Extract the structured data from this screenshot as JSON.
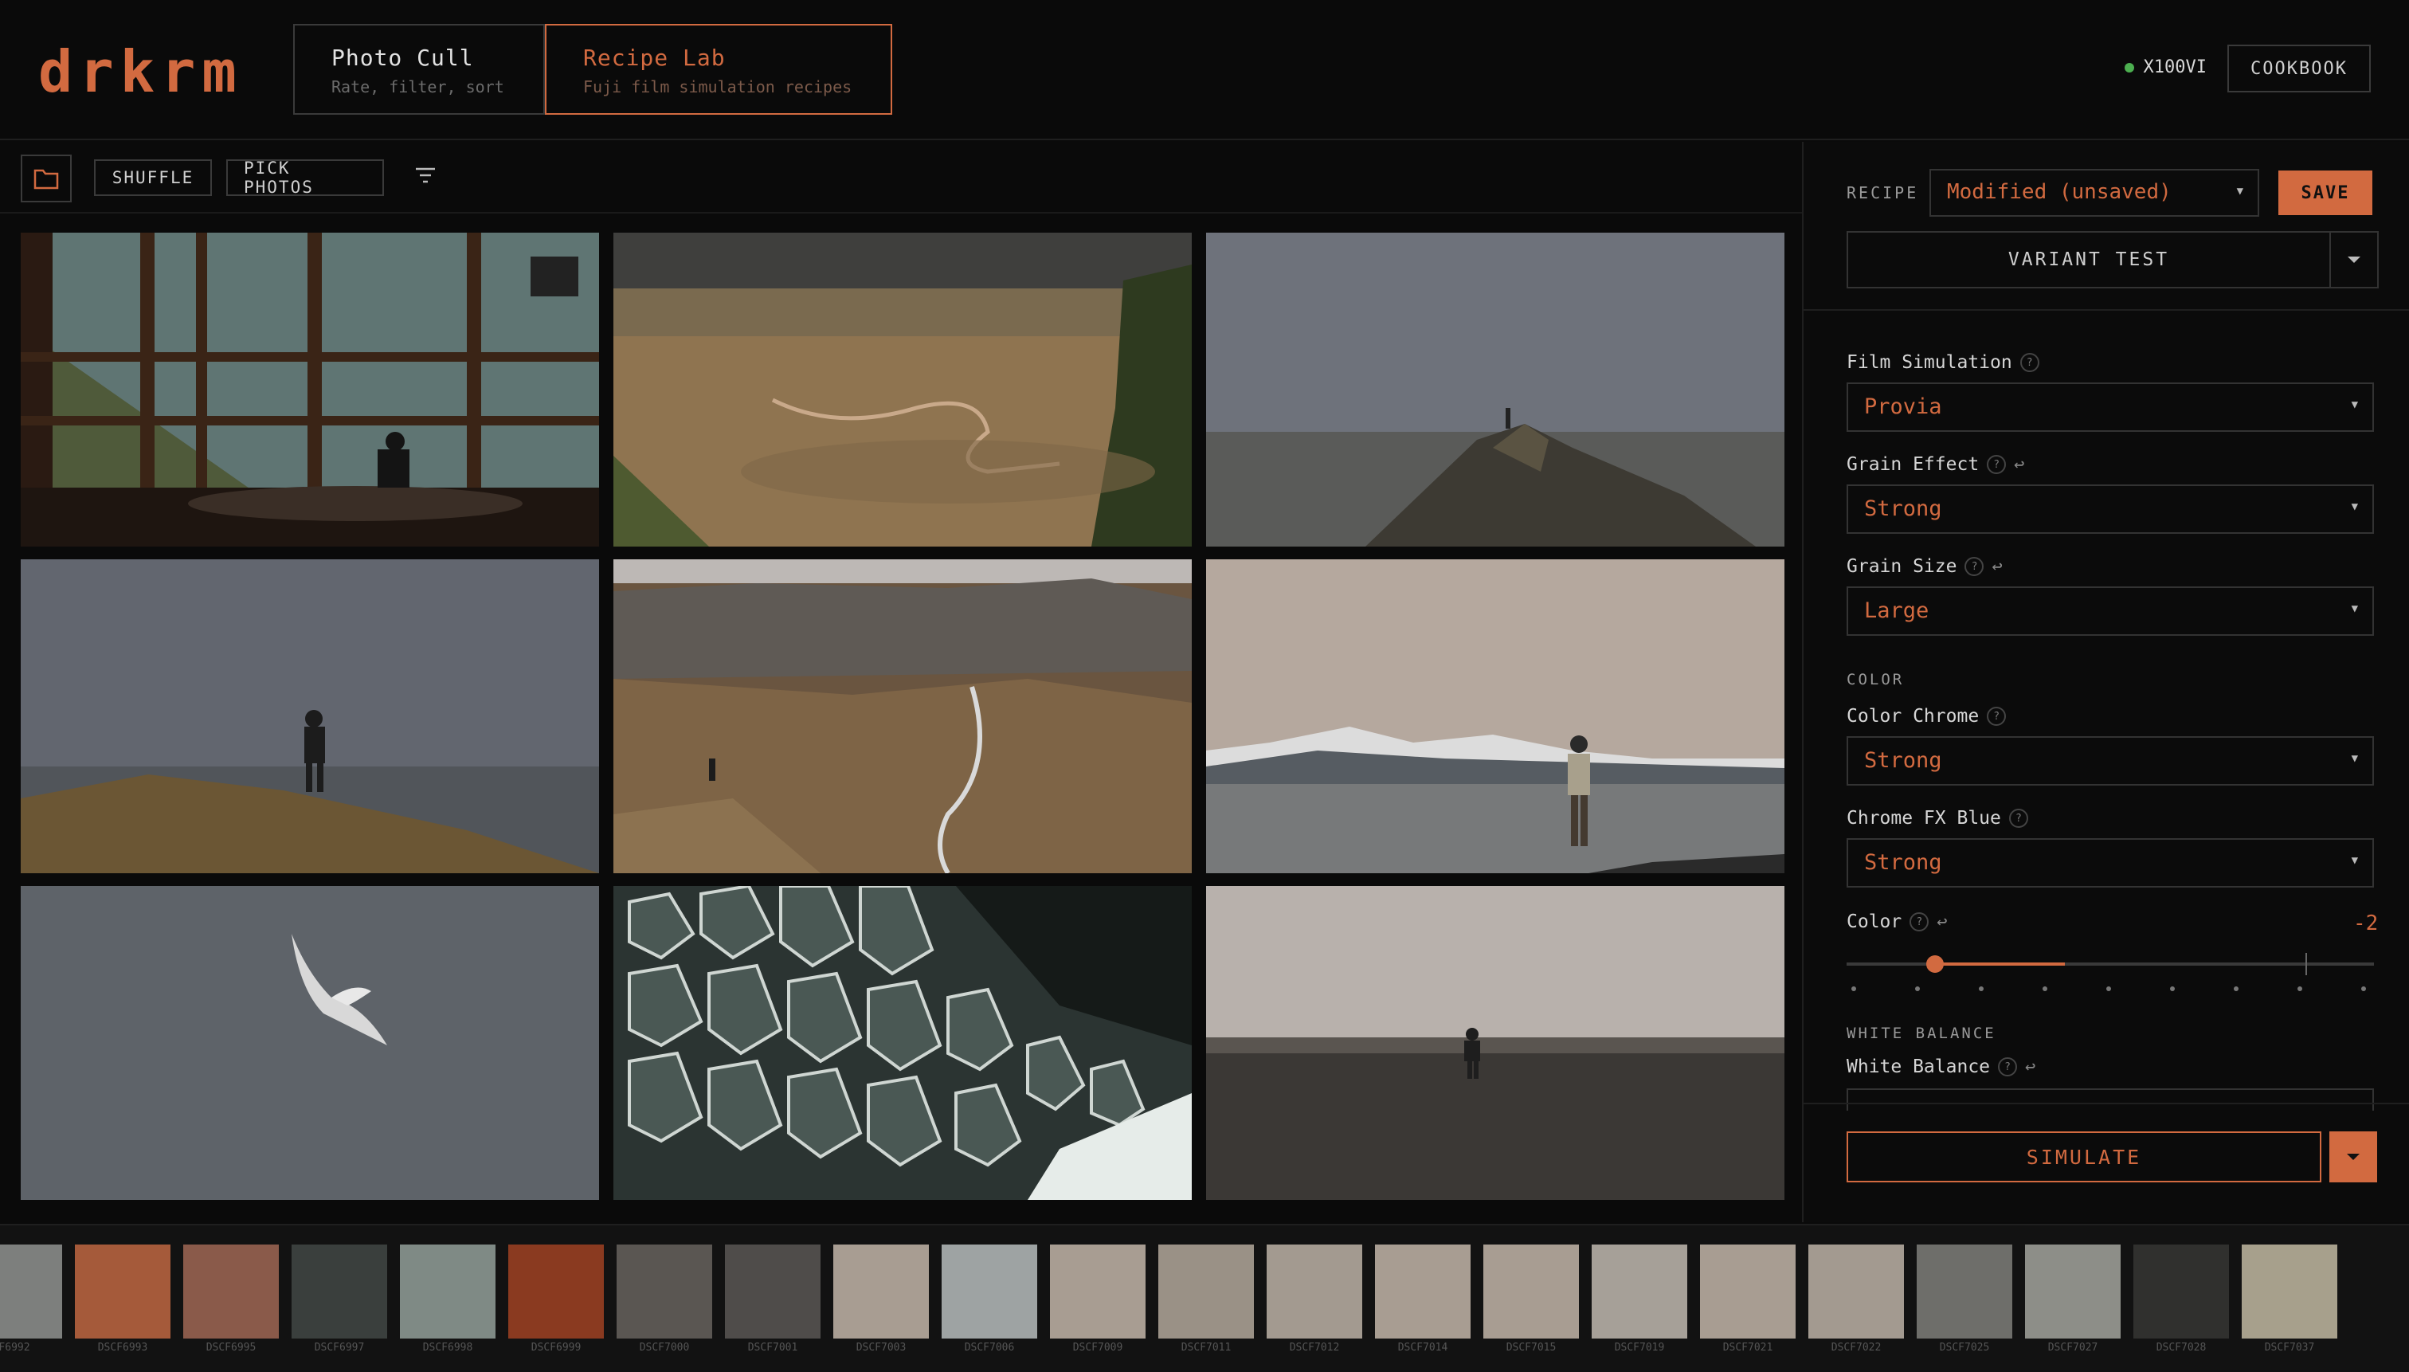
{
  "app": {
    "logo": "drkrm"
  },
  "tabs": [
    {
      "title": "Photo Cull",
      "subtitle": "Rate, filter, sort"
    },
    {
      "title": "Recipe Lab",
      "subtitle": "Fuji film simulation recipes"
    }
  ],
  "header": {
    "camera": "X100VI",
    "cookbook": "COOKBOOK"
  },
  "toolbar": {
    "shuffle": "SHUFFLE",
    "pick": "PICK PHOTOS"
  },
  "panel": {
    "recipe_label": "RECIPE",
    "recipe_value": "Modified (unsaved)",
    "save": "SAVE",
    "variant": "VARIANT TEST",
    "fields": [
      {
        "label": "Film Simulation",
        "value": "Provia"
      },
      {
        "label": "Grain Effect",
        "value": "Strong"
      },
      {
        "label": "Grain Size",
        "value": "Large"
      },
      {
        "label": "Color Chrome",
        "value": "Strong"
      },
      {
        "label": "Chrome FX Blue",
        "value": "Strong"
      }
    ],
    "section_color": "COLOR",
    "color_label": "Color",
    "color_value": "-2",
    "section_wb": "WHITE BALANCE",
    "wb_label": "White Balance",
    "simulate": "SIMULATE"
  },
  "filmstrip": [
    "F6992",
    "DSCF6993",
    "DSCF6995",
    "DSCF6997",
    "DSCF6998",
    "DSCF6999",
    "DSCF7000",
    "DSCF7001",
    "DSCF7003",
    "DSCF7006",
    "DSCF7009",
    "DSCF7011",
    "DSCF7012",
    "DSCF7014",
    "DSCF7015",
    "DSCF7019",
    "DSCF7021",
    "DSCF7022",
    "DSCF7025",
    "DSCF7027",
    "DSCF7028",
    "DSCF7037"
  ],
  "colors": {
    "accent": "#d26a40",
    "status": "#4caf50"
  }
}
